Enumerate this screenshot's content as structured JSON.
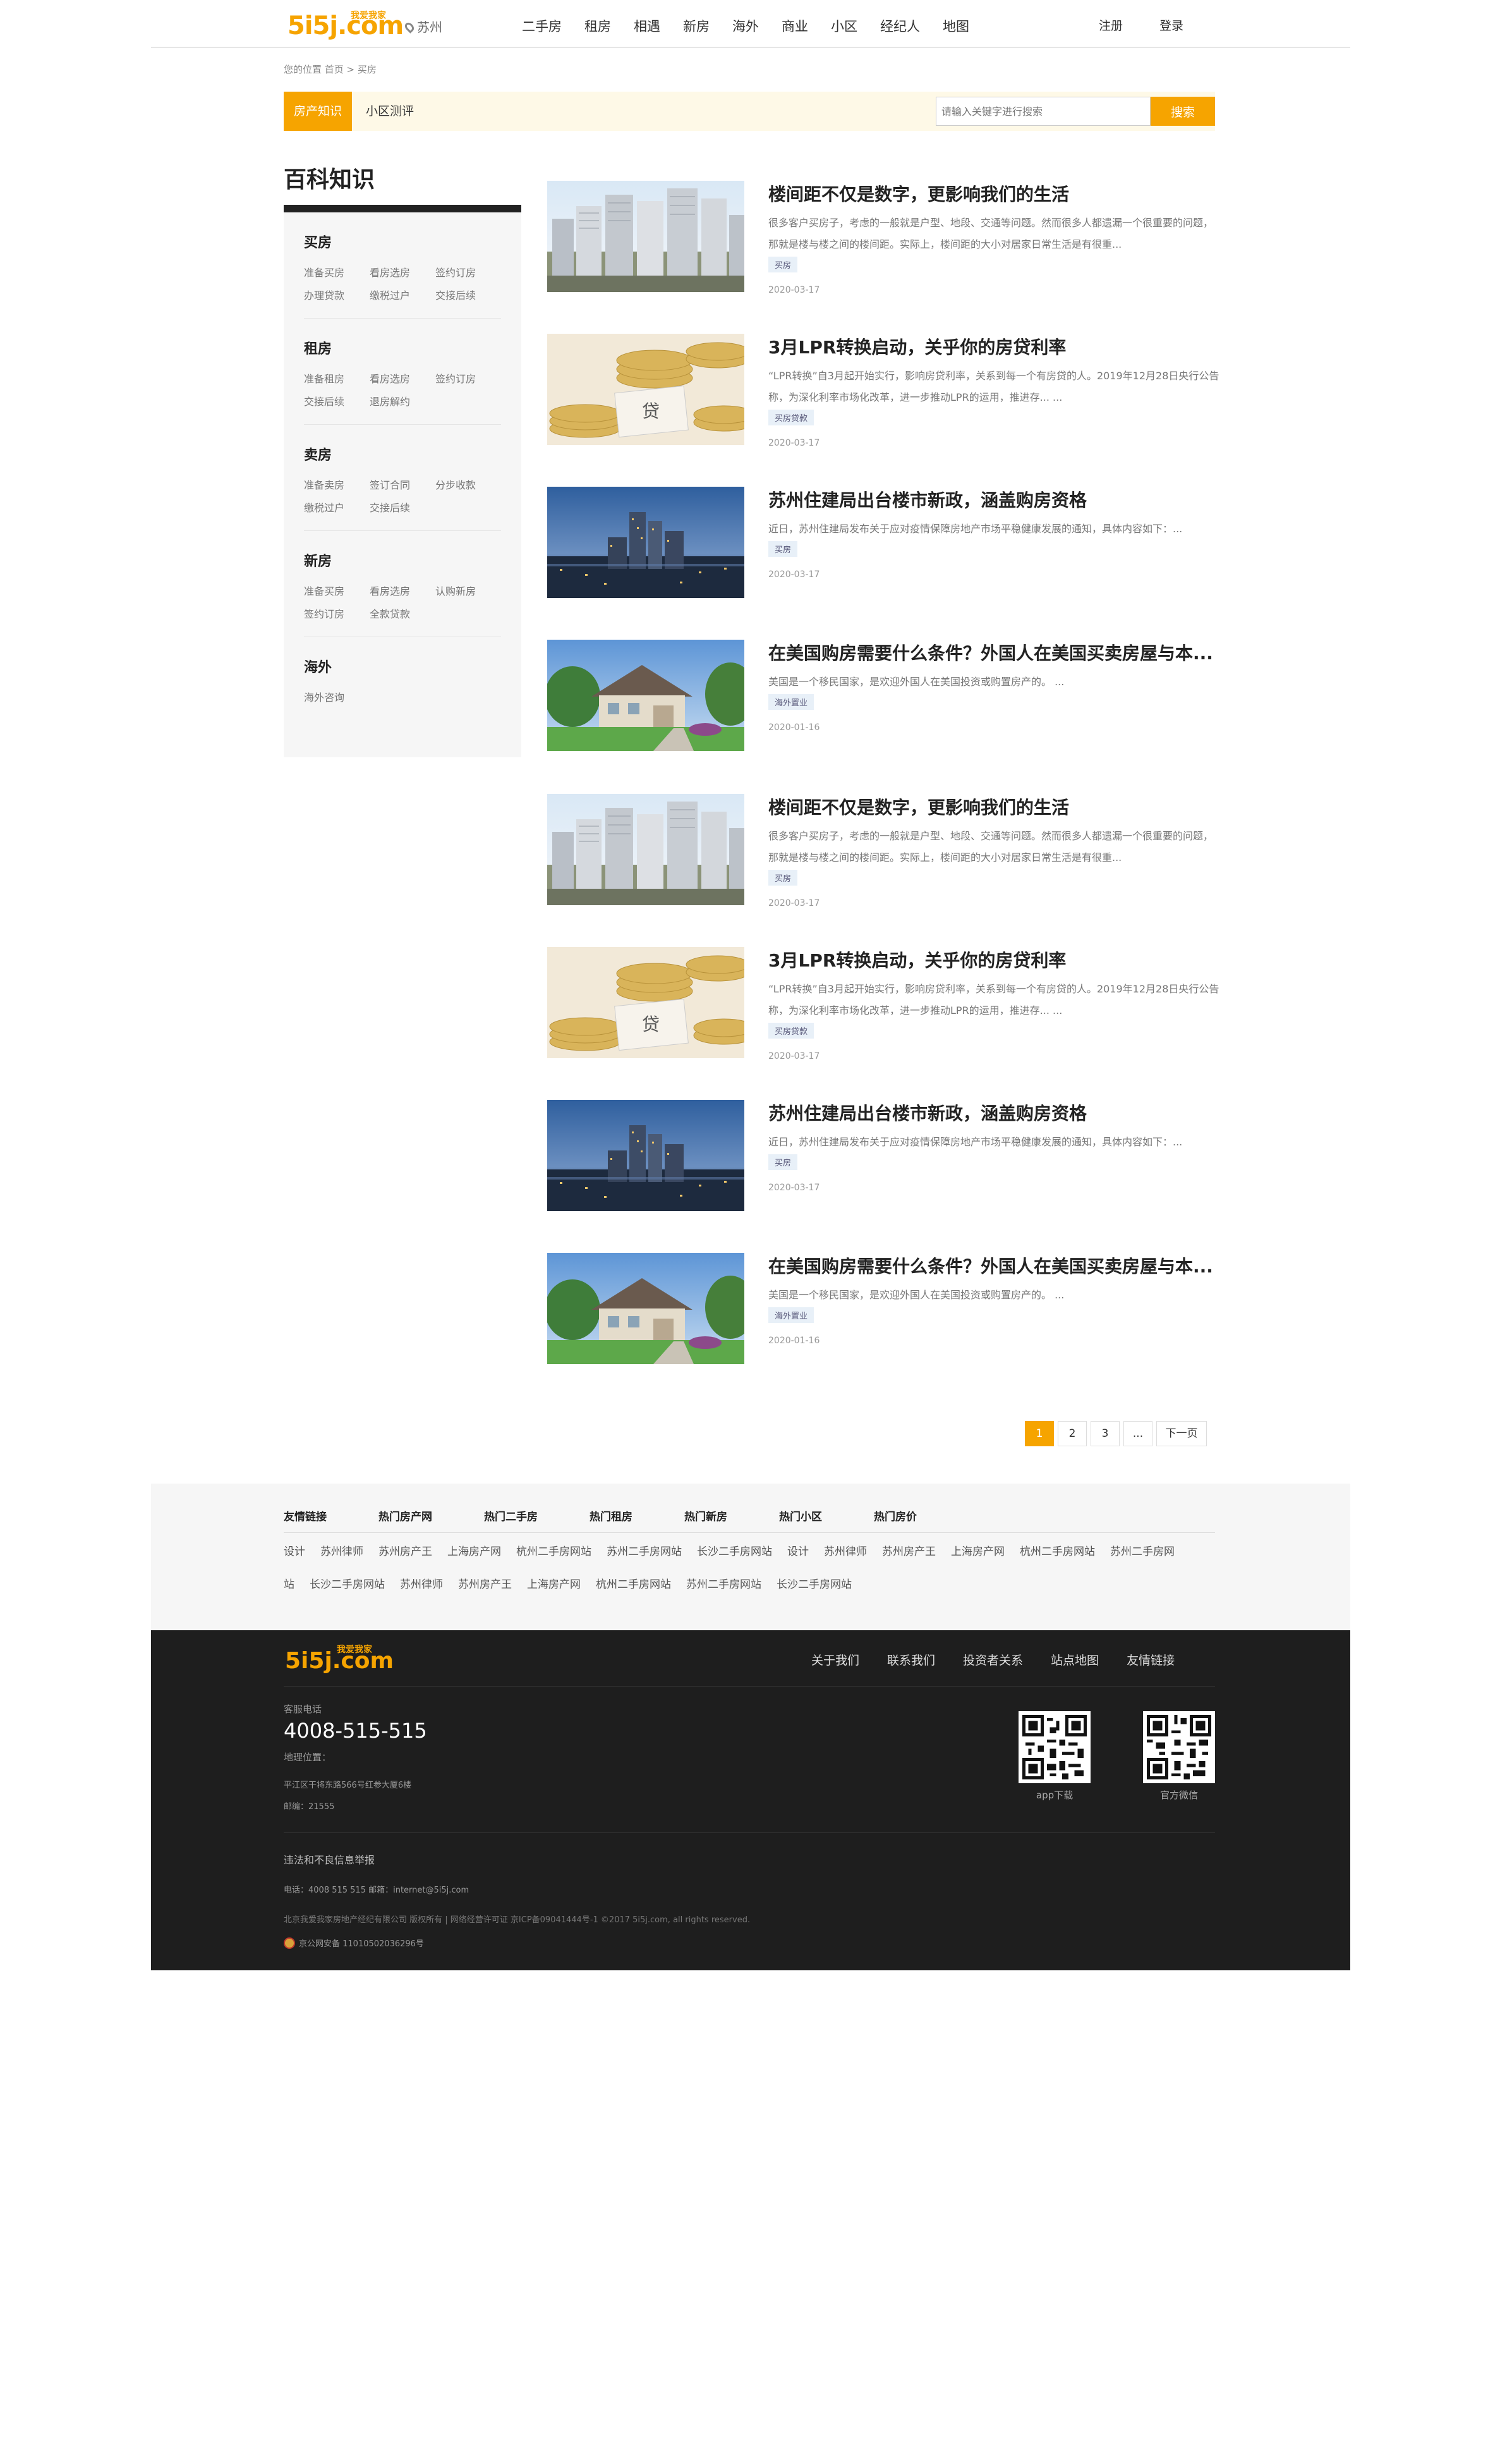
{
  "header": {
    "logo": "5i5j.com",
    "logo_slogan": "我爱我家",
    "city": "苏州",
    "nav": [
      "二手房",
      "租房",
      "相遇",
      "新房",
      "海外",
      "商业",
      "小区",
      "经纪人",
      "地图"
    ],
    "register": "注册",
    "login": "登录"
  },
  "breadcrumb": "您的位置 首页 > 买房",
  "tabs": {
    "active": "房产知识",
    "second": "小区测评",
    "search_placeholder": "请输入关键字进行搜索",
    "search_button": "搜索"
  },
  "sidebar": {
    "title": "百科知识",
    "categories": [
      {
        "title": "买房",
        "links": [
          "准备买房",
          "看房选房",
          "签约订房",
          "办理贷款",
          "缴税过户",
          "交接后续"
        ]
      },
      {
        "title": "租房",
        "links": [
          "准备租房",
          "看房选房",
          "签约订房",
          "交接后续",
          "退房解约"
        ]
      },
      {
        "title": "卖房",
        "links": [
          "准备卖房",
          "签订合同",
          "分步收款",
          "缴税过户",
          "交接后续"
        ]
      },
      {
        "title": "新房",
        "links": [
          "准备买房",
          "看房选房",
          "认购新房",
          "签约订房",
          "全款贷款"
        ]
      },
      {
        "title": "海外",
        "links": [
          "海外咨询"
        ]
      }
    ]
  },
  "articles": [
    {
      "title": "楼间距不仅是数字，更影响我们的生活",
      "summary": "很多客户买房子，考虑的一般就是户型、地段、交通等问题。然而很多人都遗漏一个很重要的问题，那就是楼与楼之间的楼间距。实际上，楼间距的大小对居家日常生活是有很重...",
      "tag": "买房",
      "date": "2020-03-17",
      "image": "buildings"
    },
    {
      "title": "3月LPR转换启动，关乎你的房贷利率",
      "summary": "“LPR转换”自3月起开始实行，影响房贷利率，关系到每一个有房贷的人。2019年12月28日央行公告称，为深化利率市场化改革，进一步推动LPR的运用，推进存... ...",
      "tag": "买房贷款",
      "date": "2020-03-17",
      "image": "coins"
    },
    {
      "title": "苏州住建局出台楼市新政，涵盖购房资格",
      "summary": "近日，苏州住建局发布关于应对疫情保障房地产市场平稳健康发展的通知，具体内容如下：...",
      "tag": "买房",
      "date": "2020-03-17",
      "image": "city"
    },
    {
      "title": "在美国购房需要什么条件？外国人在美国买卖房屋与本...",
      "summary": "美国是一个移民国家，是欢迎外国人在美国投资或购置房产的。 ...",
      "tag": "海外置业",
      "date": "2020-01-16",
      "image": "house"
    },
    {
      "title": "楼间距不仅是数字，更影响我们的生活",
      "summary": "很多客户买房子，考虑的一般就是户型、地段、交通等问题。然而很多人都遗漏一个很重要的问题，那就是楼与楼之间的楼间距。实际上，楼间距的大小对居家日常生活是有很重...",
      "tag": "买房",
      "date": "2020-03-17",
      "image": "buildings"
    },
    {
      "title": "3月LPR转换启动，关乎你的房贷利率",
      "summary": "“LPR转换”自3月起开始实行，影响房贷利率，关系到每一个有房贷的人。2019年12月28日央行公告称，为深化利率市场化改革，进一步推动LPR的运用，推进存... ...",
      "tag": "买房贷款",
      "date": "2020-03-17",
      "image": "coins"
    },
    {
      "title": "苏州住建局出台楼市新政，涵盖购房资格",
      "summary": "近日，苏州住建局发布关于应对疫情保障房地产市场平稳健康发展的通知，具体内容如下：...",
      "tag": "买房",
      "date": "2020-03-17",
      "image": "city"
    },
    {
      "title": "在美国购房需要什么条件？外国人在美国买卖房屋与本...",
      "summary": "美国是一个移民国家，是欢迎外国人在美国投资或购置房产的。 ...",
      "tag": "海外置业",
      "date": "2020-01-16",
      "image": "house"
    }
  ],
  "pagination": {
    "pages": [
      "1",
      "2",
      "3",
      "..."
    ],
    "current": "1",
    "next": "下一页"
  },
  "links": {
    "tabs": [
      "友情链接",
      "热门房产网",
      "热门二手房",
      "热门租房",
      "热门新房",
      "热门小区",
      "热门房价"
    ],
    "row1": [
      "设计",
      "苏州律师",
      "苏州房产王",
      "上海房产网",
      "杭州二手房网站",
      "苏州二手房网站",
      "长沙二手房网站",
      "设计",
      "苏州律师",
      "苏州房产王",
      "上海房产网",
      "杭州二手房网站",
      "苏州二手房网"
    ],
    "row2": [
      "站",
      "长沙二手房网站",
      "苏州律师",
      "苏州房产王",
      "上海房产网",
      "杭州二手房网站",
      "苏州二手房网站",
      "长沙二手房网站"
    ]
  },
  "footer": {
    "logo": "5i5j.com",
    "logo_slogan": "我爱我家",
    "nav": [
      "关于我们",
      "联系我们",
      "投资者关系",
      "站点地图",
      "友情链接"
    ],
    "service_label": "客服电话",
    "phone": "4008-515-515",
    "address_label": "地理位置：",
    "address": "平江区干将东路566号红参大厦6楼",
    "postcode": "邮编：21555",
    "qr1_label": "app下载",
    "qr2_label": "官方微信",
    "report": "违法和不良信息举报",
    "contact": "电话：4008 515 515    邮箱：internet@5i5j.com",
    "copyright": "北京我爱我家房地产经纪有限公司 版权所有 | 网络经营许可证 京ICP备09041444号-1 ©2017 5i5j.com, all rights reserved.",
    "police": "京公网安备 11010502036296号"
  },
  "colors": {
    "accent": "#f6a400",
    "footer_bg": "#1e1e1e",
    "links_bg": "#f6f6f6",
    "tabbar_bg": "#fef9e7"
  }
}
